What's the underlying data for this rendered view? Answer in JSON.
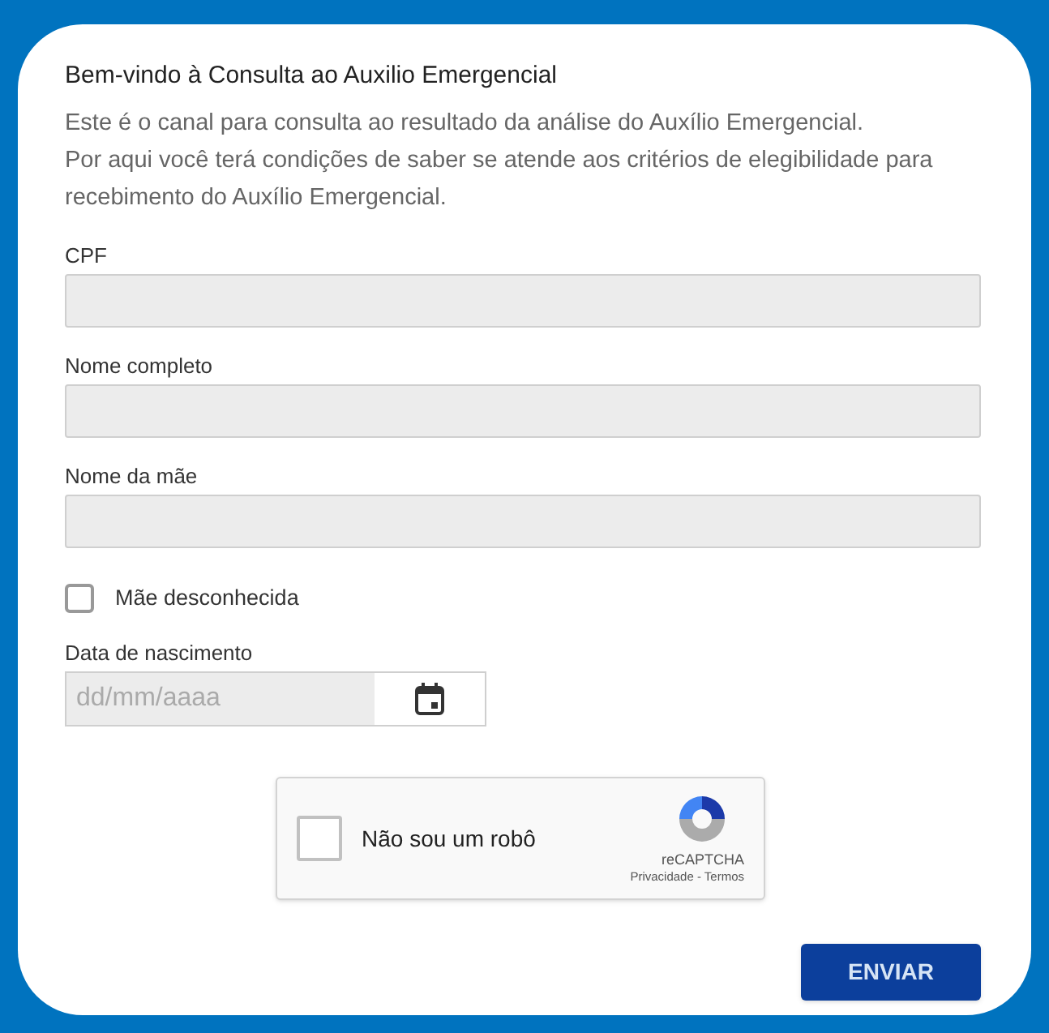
{
  "title": "Bem-vindo à Consulta ao Auxilio Emergencial",
  "intro": [
    "Este é o canal para consulta ao resultado da análise do Auxílio Emergencial.",
    "Por aqui você terá condições de saber se atende aos critérios de elegibilidade para recebimento do Auxílio Emergencial."
  ],
  "fields": [
    {
      "label": "CPF"
    },
    {
      "label": "Nome completo"
    },
    {
      "label": "Nome da mãe"
    }
  ],
  "unknown_mother": {
    "label": "Mãe desconhecida",
    "checked": false
  },
  "birth_date": {
    "label": "Data de nascimento",
    "placeholder": "dd/mm/aaaa"
  },
  "captcha": {
    "label": "Não sou um robô",
    "checked": false,
    "brand": "reCAPTCHA",
    "links": "Privacidade - Termos"
  },
  "submit": "ENVIAR"
}
